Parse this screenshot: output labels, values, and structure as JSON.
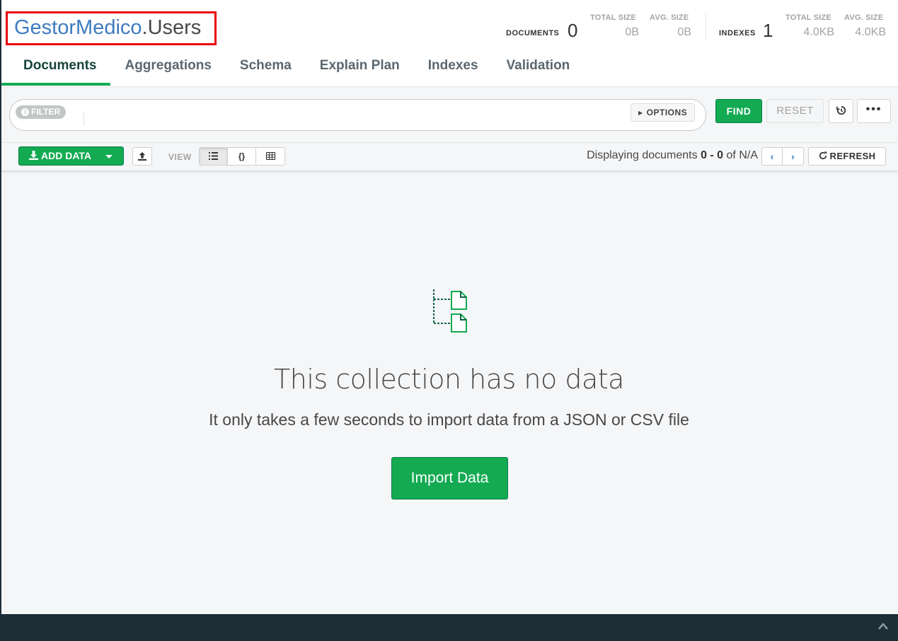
{
  "namespace": {
    "database": "GestorMedico",
    "separator": ".",
    "collection": "Users"
  },
  "stats": {
    "documents": {
      "label": "DOCUMENTS",
      "count": "0",
      "total_size_label": "TOTAL SIZE",
      "total_size": "0B",
      "avg_size_label": "AVG. SIZE",
      "avg_size": "0B"
    },
    "indexes": {
      "label": "INDEXES",
      "count": "1",
      "total_size_label": "TOTAL SIZE",
      "total_size": "4.0KB",
      "avg_size_label": "AVG. SIZE",
      "avg_size": "4.0KB"
    }
  },
  "tabs": [
    {
      "label": "Documents",
      "active": true
    },
    {
      "label": "Aggregations"
    },
    {
      "label": "Schema"
    },
    {
      "label": "Explain Plan"
    },
    {
      "label": "Indexes"
    },
    {
      "label": "Validation"
    }
  ],
  "filter": {
    "badge": "FILTER",
    "value": "",
    "options_label": "OPTIONS"
  },
  "query_buttons": {
    "find": "FIND",
    "reset": "RESET",
    "more": "•••"
  },
  "toolbar": {
    "add_data": "ADD DATA",
    "view_label": "VIEW",
    "view_modes": [
      "list",
      "json",
      "table"
    ],
    "displaying_prefix": "Displaying documents",
    "range": "0 - 0",
    "of": "of",
    "total": "N/A",
    "refresh": "REFRESH"
  },
  "empty_state": {
    "title": "This collection has no data",
    "subtitle": "It only takes a few seconds to import data from a JSON or CSV file",
    "import_button": "Import Data"
  },
  "colors": {
    "accent": "#13aa52",
    "link": "#3d7bbf",
    "highlight_box": "#e8000b",
    "footer": "#1f2d37"
  }
}
